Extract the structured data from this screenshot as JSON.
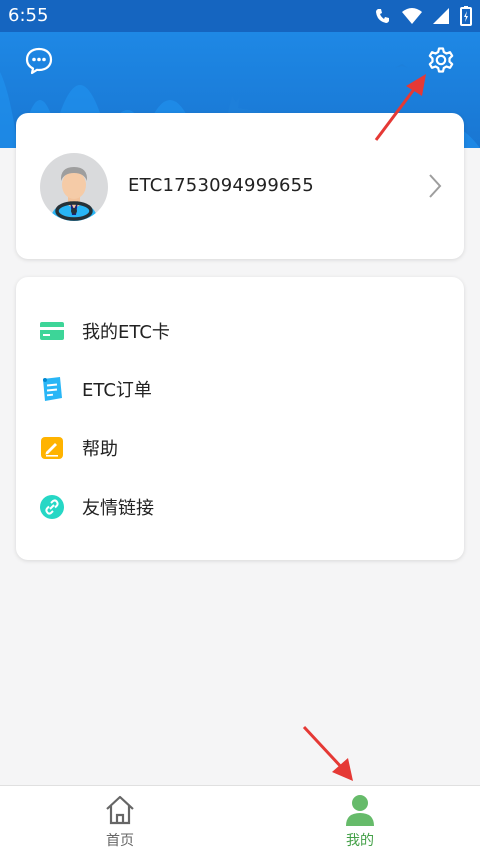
{
  "status_bar": {
    "time": "6:55"
  },
  "header": {
    "accent": "#1976d2",
    "message_icon": "chat-bubble-icon",
    "settings_icon": "gear-icon"
  },
  "profile": {
    "username": "ETC1753094999655"
  },
  "menu": {
    "items": [
      {
        "label": "我的ETC卡",
        "icon": "card-icon",
        "color": "#3dd598"
      },
      {
        "label": "ETC订单",
        "icon": "order-list-icon",
        "color": "#29b6f6"
      },
      {
        "label": "帮助",
        "icon": "edit-pencil-icon",
        "color": "#ffb300"
      },
      {
        "label": "友情链接",
        "icon": "link-icon",
        "color": "#26d7c5"
      }
    ]
  },
  "tabbar": {
    "tabs": [
      {
        "label": "首页",
        "icon": "home-icon",
        "active": false
      },
      {
        "label": "我的",
        "icon": "person-icon",
        "active": true
      }
    ],
    "active_color": "#43a047",
    "inactive_color": "#666666"
  },
  "annotations": {
    "arrow_color": "#e53935"
  }
}
